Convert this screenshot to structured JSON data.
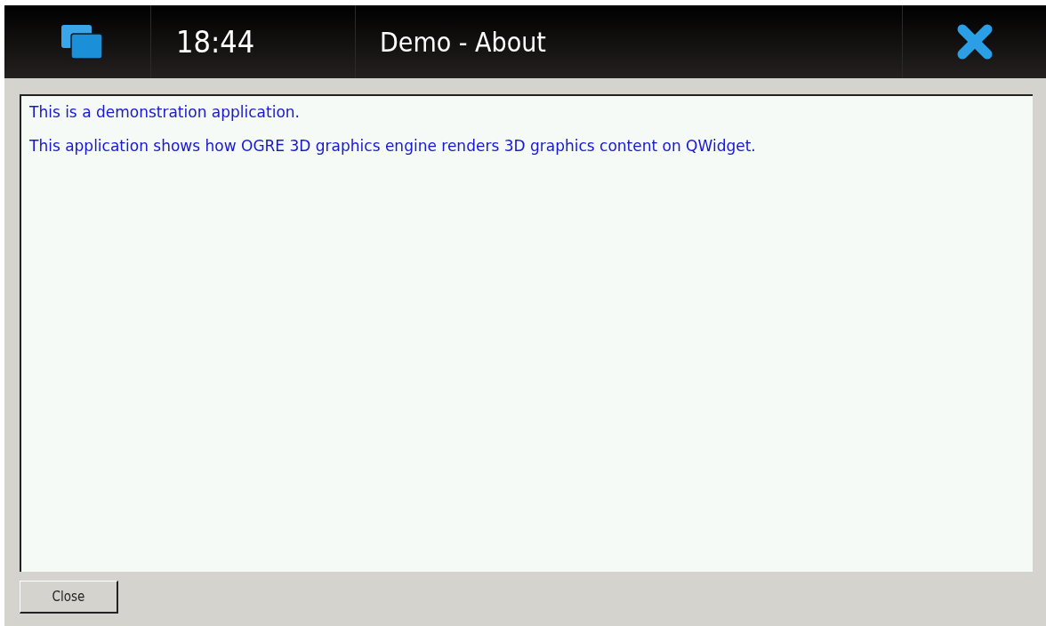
{
  "status_bar": {
    "time": "18:44",
    "title": "Demo - About"
  },
  "text_area": {
    "lines": [
      "This is a demonstration application.",
      "This application shows how OGRE 3D graphics engine renders 3D graphics content on QWidget."
    ]
  },
  "buttons": [
    "Close"
  ]
}
